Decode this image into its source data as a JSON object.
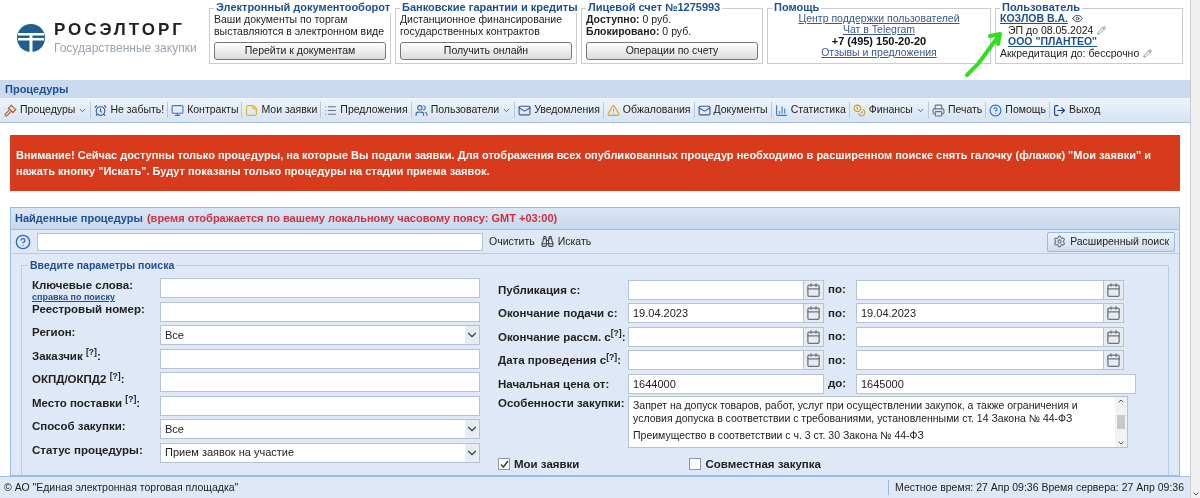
{
  "logo": {
    "name": "РОСЭЛТОРГ",
    "subtitle": "Государственные закупки"
  },
  "header_boxes": [
    {
      "title": "Электронный документооборот",
      "lines": [
        "Ваши документы по торгам",
        "выставляются в электронном виде"
      ],
      "button": "Перейти к документам"
    },
    {
      "title": "Банковские гарантии и кредиты",
      "lines": [
        "Дистанционное финансирование",
        "государственных контрактов"
      ],
      "button": "Получить онлайн"
    },
    {
      "title": "Лицевой счет №1275993",
      "lines": [
        "**Доступно:** 0 руб.",
        "**Блокировано:** 0 руб."
      ],
      "button": "Операции по счету"
    }
  ],
  "help": {
    "title": "Помощь",
    "items": [
      {
        "kind": "link",
        "text": "Центр поддержки пользователей"
      },
      {
        "kind": "link",
        "text": "Чат в Telegram"
      },
      {
        "kind": "phone",
        "text": "+7 (495) 150-20-20"
      },
      {
        "kind": "link",
        "text": "Отзывы и предложения"
      }
    ]
  },
  "user": {
    "title": "Пользователь",
    "name": "КОЗЛОВ В.А.",
    "signature": "ЭП до 08.05.2024",
    "org": "ООО \"ПЛАНТЕО\"",
    "accreditation": "Аккредитация до: бессрочно"
  },
  "section_title": "Процедуры",
  "toolbar": [
    {
      "label": "Процедуры",
      "dropdown": true
    },
    {
      "label": "Не забыть!",
      "dropdown": false
    },
    {
      "label": "Контракты",
      "dropdown": false
    },
    {
      "label": "Мои заявки",
      "dropdown": false
    },
    {
      "label": "Предложения",
      "dropdown": false
    },
    {
      "label": "Пользователи",
      "dropdown": true
    },
    {
      "label": "Уведомления",
      "dropdown": false
    },
    {
      "label": "Обжалования",
      "dropdown": false
    },
    {
      "label": "Документы",
      "dropdown": false
    },
    {
      "label": "Статистика",
      "dropdown": false
    },
    {
      "label": "Финансы",
      "dropdown": true
    },
    {
      "label": "Печать",
      "dropdown": false
    },
    {
      "label": "Помощь",
      "dropdown": false
    },
    {
      "label": "Выход",
      "dropdown": false
    }
  ],
  "alert": "Внимание! Сейчас доступны только процедуры, на которые Вы подали заявки. Для отображения всех опубликованных процедур необходимо в расширенном поиске снять галочку (флажок) \"Мои заявки\" и нажать кнопку \"Искать\". Будут показаны только процедуры на стадии приема заявок.",
  "panel": {
    "title": "Найденные процедуры",
    "note": "(время отображается по вашему локальному часовому поясу: GMT +03:00)",
    "search": {
      "clear": "Очистить",
      "find": "Искать",
      "advanced": "Расширенный поиск"
    },
    "fieldset": "Введите параметры поиска",
    "left_fields": [
      {
        "kind": "text",
        "label": "Ключевые слова:",
        "help_link": "справка по поиску"
      },
      {
        "kind": "text",
        "label": "Реестровый номер:"
      },
      {
        "kind": "select",
        "label": "Регион:",
        "value": "Все"
      },
      {
        "kind": "text",
        "label": "Заказчик $^{[?]}$:"
      },
      {
        "kind": "text",
        "label": "ОКПД/ОКПД2 $^{[?]}$:"
      },
      {
        "kind": "text",
        "label": "Место поставки $^{[?]}$:"
      },
      {
        "kind": "select",
        "label": "Способ закупки:",
        "value": "Все"
      },
      {
        "kind": "select",
        "label": "Статус процедуры:",
        "value": "Прием заявок на участие"
      }
    ],
    "right_fields": [
      {
        "kind": "date",
        "label": "Публикация с:",
        "to_label": "по:"
      },
      {
        "kind": "date",
        "label": "Окончание подачи с:",
        "from": "19.04.2023",
        "to_label": "по:",
        "to": "19.04.2023"
      },
      {
        "kind": "date",
        "label": "Окончание рассм. с$^{[?]}$:",
        "to_label": "по:"
      },
      {
        "kind": "date",
        "label": "Дата проведения с$^{[?]}$:",
        "to_label": "по:"
      },
      {
        "kind": "range",
        "label": "Начальная цена от:",
        "from": "1644000",
        "to_label": "до:",
        "to": "1645000"
      },
      {
        "kind": "textarea",
        "label": "Особенности закупки:",
        "lines": [
          "Запрет на допуск товаров, работ, услуг при осуществлении закупок, а также ограничения и условия допуска в соответствии с требованиями, установленными ст. 14 Закона № 44-ФЗ",
          "Преимущество в соответствии с ч. 3 ст. 30 Закона № 44-ФЗ"
        ]
      }
    ],
    "checkboxes": [
      {
        "label": "Мои заявки",
        "checked": true
      },
      {
        "label": "Совместная закупка",
        "checked": false
      }
    ]
  },
  "status_bar": {
    "copyright": "© АО \"Единая электронная торговая площадка\"",
    "time": "Местное время: 27 Апр 09:36 Время сервера: 27 Апр 09:36"
  }
}
